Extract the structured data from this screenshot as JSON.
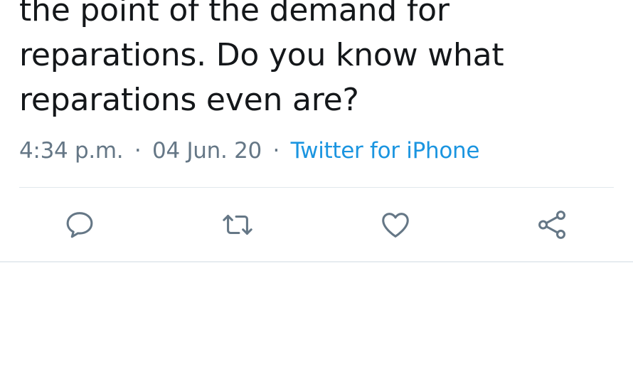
{
  "tweet": {
    "lines": [
      "the point of the demand for",
      "reparations. Do you know what",
      "reparations even are?"
    ],
    "time": "4:34 p.m.",
    "separator": "·",
    "date": "04 Jun. 20",
    "source": "Twitter for iPhone"
  },
  "actions": {
    "reply_icon": "reply-icon",
    "retweet_icon": "retweet-icon",
    "like_icon": "heart-icon",
    "share_icon": "share-icon"
  },
  "colors": {
    "text": "#14171a",
    "meta": "#657786",
    "link": "#1b95e0",
    "icon": "#657786",
    "divider": "#e1e8ed"
  }
}
